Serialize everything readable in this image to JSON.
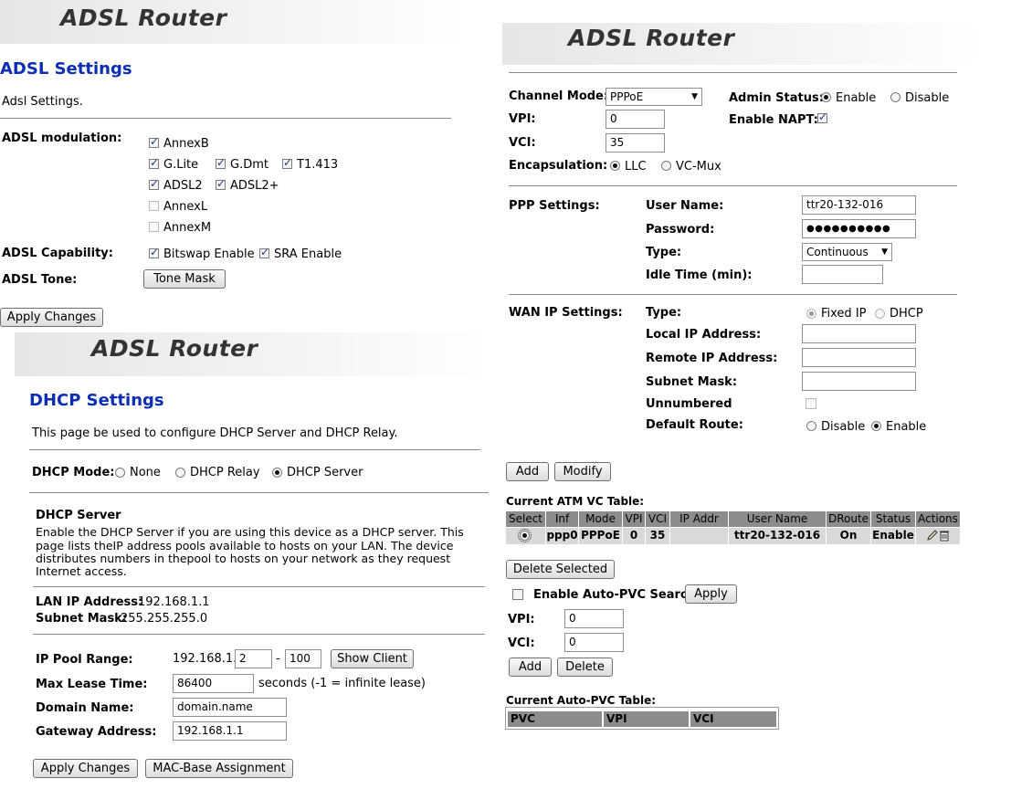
{
  "banner_title": "ADSL Router",
  "adsl": {
    "title": "ADSL Settings",
    "description": "Adsl Settings.",
    "modulation_label": "ADSL modulation:",
    "modulations": {
      "annexb": "AnnexB",
      "glite": "G.Lite",
      "gdmt": "G.Dmt",
      "t1413": "T1.413",
      "adsl2": "ADSL2",
      "adsl2plus": "ADSL2+",
      "annexl": "AnnexL",
      "annexm": "AnnexM"
    },
    "capability_label": "ADSL Capability:",
    "bitswap": "Bitswap Enable",
    "sra": "SRA Enable",
    "tone_label": "ADSL Tone:",
    "tone_button": "Tone Mask",
    "apply_button": "Apply Changes"
  },
  "dhcp": {
    "title": "DHCP Settings",
    "description": "This page be used to configure DHCP Server and DHCP Relay.",
    "mode_label": "DHCP Mode:",
    "mode_none": "None",
    "mode_relay": "DHCP Relay",
    "mode_server": "DHCP Server",
    "server_heading": "DHCP Server",
    "server_desc": [
      "Enable the DHCP Server if you are using this device as a DHCP server. This",
      "page lists theIP address pools available to hosts on your LAN. The device",
      "distributes numbers in thepool to hosts on your network as they request",
      "Internet access."
    ],
    "lan_ip_label": "LAN IP Address:",
    "lan_ip": "192.168.1.1",
    "subnet_label": "Subnet Mask:",
    "subnet": "255.255.255.0",
    "pool_label": "IP Pool Range:",
    "pool_prefix": "192.168.1.",
    "pool_start": "2",
    "pool_dash": "-",
    "pool_end": "100",
    "show_client": "Show Client",
    "lease_label": "Max Lease Time:",
    "lease_value": "86400",
    "lease_unit": "seconds (-1 = infinite lease)",
    "domain_label": "Domain Name:",
    "domain_value": "domain.name",
    "gateway_label": "Gateway Address:",
    "gateway_value": "192.168.1.1",
    "apply_button": "Apply Changes",
    "mac_button": "MAC-Base Assignment"
  },
  "wan": {
    "channel_mode_label": "Channel Mode:",
    "channel_mode": "PPPoE",
    "admin_status_label": "Admin Status:",
    "admin_enable": "Enable",
    "admin_disable": "Disable",
    "vpi_label": "VPI:",
    "vpi": "0",
    "napt_label": "Enable NAPT:",
    "vci_label": "VCI:",
    "vci": "35",
    "encap_label": "Encapsulation:",
    "encap_llc": "LLC",
    "encap_vcmux": "VC-Mux",
    "ppp_label": "PPP Settings:",
    "username_label": "User Name:",
    "username": "ttr20-132-016",
    "password_label": "Password:",
    "password": "●●●●●●●●●●",
    "type_label": "Type:",
    "type_value": "Continuous",
    "idle_label": "Idle Time (min):",
    "wanip_label": "WAN IP Settings:",
    "wanip_type_label": "Type:",
    "fixed_ip": "Fixed IP",
    "dhcp": "DHCP",
    "local_ip_label": "Local IP Address:",
    "remote_ip_label": "Remote IP Address:",
    "subnet_label": "Subnet Mask:",
    "unnumbered_label": "Unnumbered",
    "default_route_label": "Default Route:",
    "route_disable": "Disable",
    "route_enable": "Enable",
    "add_button": "Add",
    "modify_button": "Modify",
    "atm_table_title": "Current ATM VC Table:",
    "atm_headers": [
      "Select",
      "Inf",
      "Mode",
      "VPI",
      "VCI",
      "IP Addr",
      "User Name",
      "DRoute",
      "Status",
      "Actions"
    ],
    "atm_row": [
      "",
      "ppp0",
      "PPPoE",
      "0",
      "35",
      "",
      "ttr20-132-016",
      "On",
      "Enable",
      ""
    ],
    "delete_selected": "Delete Selected",
    "auto_pvc_label": "Enable Auto-PVC Search",
    "apply_button": "Apply",
    "pvc_vpi_label": "VPI:",
    "pvc_vpi": "0",
    "pvc_vci_label": "VCI:",
    "pvc_vci": "0",
    "pvc_add": "Add",
    "pvc_delete": "Delete",
    "pvc_table_title": "Current Auto-PVC Table:",
    "pvc_headers": [
      "PVC",
      "VPI",
      "VCI"
    ]
  }
}
